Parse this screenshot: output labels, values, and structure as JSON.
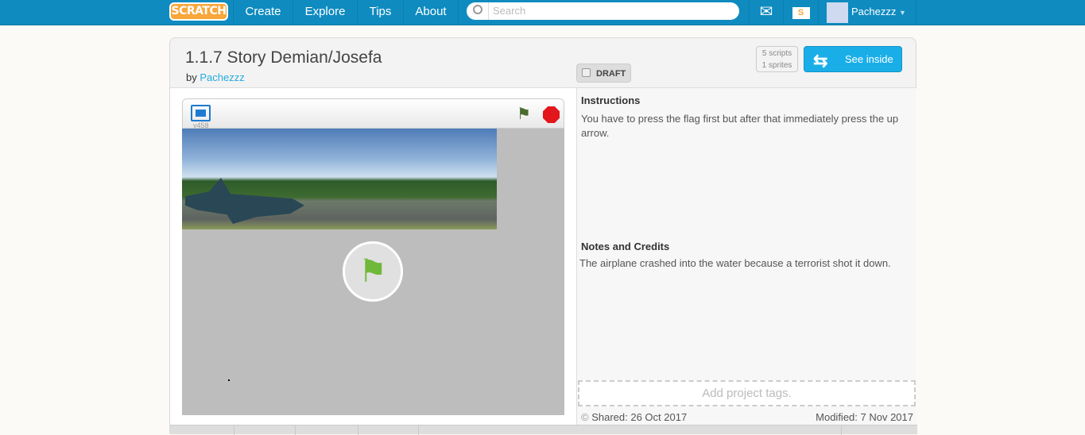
{
  "nav": {
    "logo": "SCRATCH",
    "items": [
      "Create",
      "Explore",
      "Tips",
      "About"
    ],
    "search_placeholder": "Search",
    "username": "Pachezzz",
    "messages_icon": "envelope-icon",
    "mystuff_icon": "folder-icon"
  },
  "project": {
    "title": "1.1.7 Story Demian/Josefa",
    "by_label": "by",
    "author": "Pachezzz",
    "draft_label": "DRAFT",
    "scripts": "5 scripts",
    "sprites": "1 sprites",
    "see_inside": "See inside",
    "version": "v458"
  },
  "instructions": {
    "heading": "Instructions",
    "text": "You have to press the flag first but after that immediately press the up arrow."
  },
  "notes": {
    "heading": "Notes and Credits",
    "text": "The airplane crashed into the water because a terrorist shot it down."
  },
  "tags_placeholder": "Add project tags.",
  "shared": "Shared: 26 Oct 2017",
  "modified": "Modified: 7 Nov 2017",
  "colors": {
    "nav": "#0f8bc0",
    "accent": "#1aaee8",
    "link": "#25aae1",
    "stop": "#e2161b",
    "flag": "#4a6c2f"
  }
}
